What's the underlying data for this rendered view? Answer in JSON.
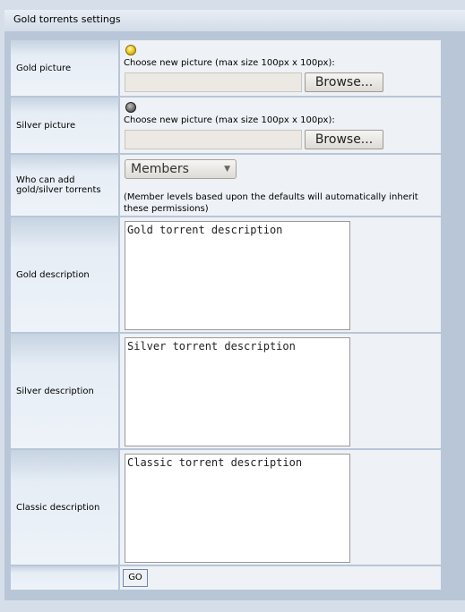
{
  "header": {
    "title": "Gold torrents settings"
  },
  "rows": {
    "gold_picture": {
      "label": "Gold picture",
      "choose_text": "Choose new picture (max size 100px x 100px):",
      "browse_label": "Browse...",
      "icon": "gold-coin-icon"
    },
    "silver_picture": {
      "label": "Silver picture",
      "choose_text": "Choose new picture (max size 100px x 100px):",
      "browse_label": "Browse...",
      "icon": "silver-coin-icon"
    },
    "who_can_add": {
      "label": "Who can add gold/silver torrents",
      "selected": "Members",
      "note": "(Member levels based upon the defaults will automatically inherit these permissions)"
    },
    "gold_description": {
      "label": "Gold description",
      "value": "Gold torrent description"
    },
    "silver_description": {
      "label": "Silver description",
      "value": "Silver torrent description"
    },
    "classic_description": {
      "label": "Classic description",
      "value": "Classic torrent description"
    }
  },
  "actions": {
    "go_label": "GO"
  },
  "colors": {
    "page_bg": "#d6dfe9",
    "panel_bg": "#b8c6d7",
    "cell_bg": "#eef1f5",
    "go_border": "#6d86ad"
  }
}
